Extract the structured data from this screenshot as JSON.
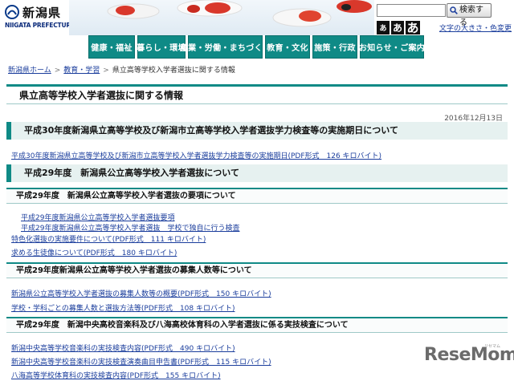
{
  "header": {
    "logo_text": "新潟県",
    "logo_sub": "NIIGATA PREFECTURE",
    "search_button": "検索する",
    "font_size_labels": [
      "あ",
      "あ",
      "あ"
    ],
    "font_color_link": "文字の大きさ・色変更"
  },
  "nav": {
    "items": [
      {
        "label": "健康・福祉"
      },
      {
        "label": "暮らし・環境"
      },
      {
        "label": "産業・労働・まちづくり"
      },
      {
        "label": "教育・文化"
      },
      {
        "label": "施策・行政"
      },
      {
        "label": "お知らせ・ご案内"
      }
    ]
  },
  "breadcrumb": {
    "home": "新潟県ホーム",
    "section": "教育・学習",
    "current": "県立高等学校入学者選抜に関する情報"
  },
  "page": {
    "title": "県立高等学校入学者選抜に関する情報",
    "date": "2016年12月13日"
  },
  "sections": {
    "s1_heading": "平成30年度新潟県立高等学校及び新潟市立高等学校入学者選抜学力検査等の実施期日について",
    "s1_link": "平成30年度新潟県立高等学校及び新潟市立高等学校入学者選抜学力検査等の実施期日(PDF形式　126 キロバイト)",
    "s2_heading": "平成29年度　新潟県公立高等学校入学者選抜について",
    "s3_heading": "平成29年度　新潟県公立高等学校入学者選抜の要項について",
    "s3_link1": "平成29年度新潟県公立高等学校入学者選抜要項",
    "s3_link2": "平成29年度新潟県公立高等学校入学者選抜　学校で独自に行う検査",
    "s3_link3": "特色化選抜の実施要件について(PDF形式　111 キロバイト)",
    "s3_link4": "求める生徒像について(PDF形式　180 キロバイト)",
    "s4_heading": "平成29年度新潟県公立高等学校入学者選抜の募集人数等について",
    "s4_link1": "新潟県公立高等学校入学者選抜の募集人数等の概要(PDF形式　150 キロバイト)",
    "s4_link2": "学校・学科ごとの募集人数と選抜方法等(PDF形式　108 キロバイト)",
    "s5_heading": "平成29年度　新潟中央高校音楽科及び八海高校体育科の入学者選抜に係る実技検査について",
    "s5_link1": "新潟中央高等学校音楽科の実技検査内容(PDF形式　490 キロバイト)",
    "s5_link2": "新潟中央高等学校音楽科の実技検査演奏曲目申告書(PDF形式　115 キロバイト)",
    "s5_link3": "八海高等学校体育科の実技検査内容(PDF形式　155 キロバイト)"
  },
  "watermark": {
    "text": "ReseMom",
    "sub": "リセマム"
  },
  "colors": {
    "accent": "#0f8a86",
    "link": "#1a3d9c",
    "heading_bg": "#e6f1f0"
  }
}
